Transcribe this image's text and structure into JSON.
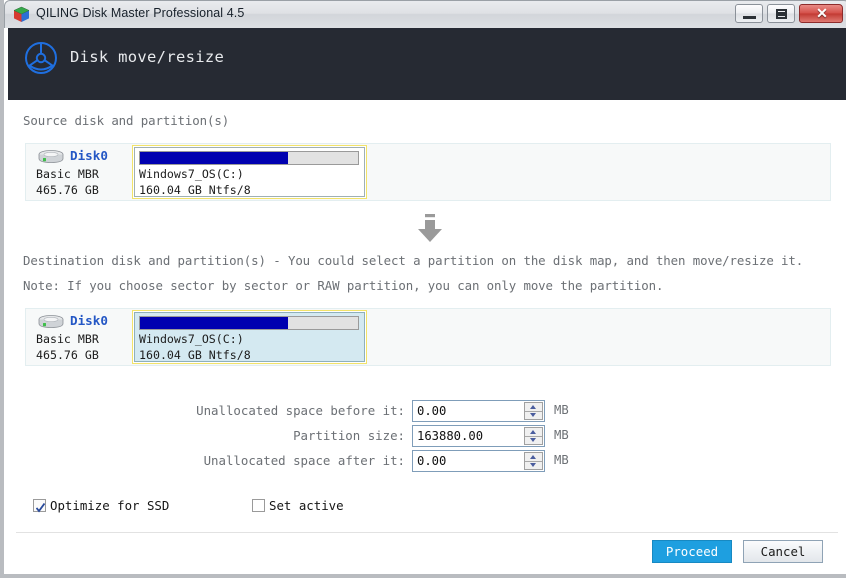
{
  "window": {
    "title": "QILING Disk Master Professional 4.5",
    "app_icon": "cube-icon",
    "controls": {
      "minimize": "minimize-icon",
      "maximize": "maximize-icon",
      "close_glyph": "✕"
    }
  },
  "header": {
    "logo": "qiling-disk-logo-icon",
    "title": "Disk move/resize"
  },
  "labels": {
    "source": "Source disk and partition(s)",
    "destination": "Destination disk and partition(s) - You could select a partition on the disk map, and then move/resize it.",
    "note": "Note: If you choose sector by sector or RAW partition, you can only move the partition.",
    "transfer_arrow": "down-arrow-icon"
  },
  "source_disk": {
    "icon": "hard-disk-icon",
    "name": "Disk0",
    "type": "Basic MBR",
    "size": "465.76 GB",
    "partition": {
      "name": "Windows7_OS(C:)",
      "size": "160.04 GB Ntfs/8",
      "used_percent": 68,
      "selected": false
    }
  },
  "destination_disk": {
    "icon": "hard-disk-icon",
    "name": "Disk0",
    "type": "Basic MBR",
    "size": "465.76 GB",
    "partition": {
      "name": "Windows7_OS(C:)",
      "size": "160.04 GB Ntfs/8",
      "used_percent": 68,
      "selected": true
    }
  },
  "fields": [
    {
      "label": "Unallocated space before it:",
      "value": "0.00",
      "unit": "MB"
    },
    {
      "label": "Partition size:",
      "value": "163880.00",
      "unit": "MB"
    },
    {
      "label": "Unallocated space after it:",
      "value": "0.00",
      "unit": "MB"
    }
  ],
  "checkboxes": {
    "optimize_ssd": {
      "label": "Optimize for SSD",
      "checked": true
    },
    "set_active": {
      "label": "Set active",
      "checked": false
    }
  },
  "footer": {
    "proceed": "Proceed",
    "cancel": "Cancel"
  },
  "colors": {
    "accent_blue": "#1e9fe0",
    "header_dark": "#262a33",
    "partition_fill": "#0000b0",
    "selection_fill": "#d4e9f1",
    "selection_border": "#f2e36a",
    "disk_name": "#2457c5"
  }
}
